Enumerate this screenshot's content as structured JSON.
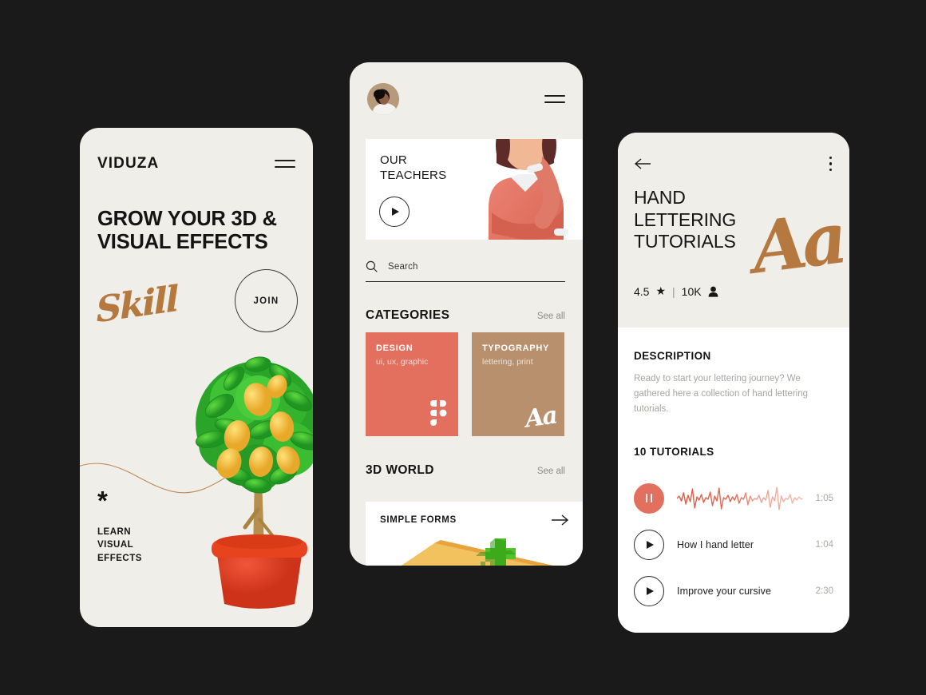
{
  "background_color": "#1a1a1a",
  "card_color": "#efeee8",
  "accent_red": "#e3705f",
  "accent_tan": "#b8906e",
  "accent_bronze": "#b5793f",
  "phone1": {
    "brand": "VIDUZA",
    "menu_icon": "hamburger-icon",
    "headline": "GROW YOUR 3D & VISUAL EFFECTS",
    "script_word": "Skill",
    "join_label": "JOIN",
    "asterisk": "*",
    "footer_line1": "LEARN",
    "footer_line2": "VISUAL",
    "footer_line3": "EFFECTS",
    "illustration": "lemon-tree-3d"
  },
  "phone2": {
    "avatar": "user-avatar",
    "menu_icon": "hamburger-icon",
    "teachers_card": {
      "title_line1": "OUR",
      "title_line2": "TEACHERS",
      "play_icon": "play-icon",
      "illustration": "thinking-woman-3d"
    },
    "search": {
      "placeholder": "Search",
      "icon": "search-icon"
    },
    "categories": {
      "title": "CATEGORIES",
      "see_all": "See all",
      "items": [
        {
          "name": "DESIGN",
          "sub": "ui, ux, graphic",
          "color": "#e3705f",
          "icon": "figma-icon"
        },
        {
          "name": "TYPOGRAPHY",
          "sub": "lettering, print",
          "color": "#b8906e",
          "icon": "aa-script-icon"
        }
      ]
    },
    "world": {
      "title": "3D WORLD",
      "see_all": "See all",
      "card_title": "SIMPLE FORMS",
      "arrow_icon": "arrow-right-icon",
      "illustration": "green-cross-3d"
    }
  },
  "phone3": {
    "back_icon": "arrow-left-icon",
    "more_icon": "kebab-menu-icon",
    "title_line1": "HAND",
    "title_line2": "LETTERING",
    "title_line3": "TUTORIALS",
    "rating": "4.5",
    "star_icon": "★",
    "divider": "|",
    "learners": "10K",
    "person_icon": "person-icon",
    "script_mark": "Aa",
    "description_title": "DESCRIPTION",
    "description_text": "Ready to start your lettering journey? We gathered here a collection of hand lettering tutorials.",
    "tutorials_title": "10 TUTORIALS",
    "tutorials": [
      {
        "label": "",
        "time": "1:05",
        "state": "playing",
        "icon": "pause-icon",
        "waveform": true
      },
      {
        "label": "How I hand letter",
        "time": "1:04",
        "state": "paused",
        "icon": "play-icon",
        "waveform": false
      },
      {
        "label": "Improve your cursive",
        "time": "2:30",
        "state": "paused",
        "icon": "play-icon",
        "waveform": false
      }
    ]
  }
}
